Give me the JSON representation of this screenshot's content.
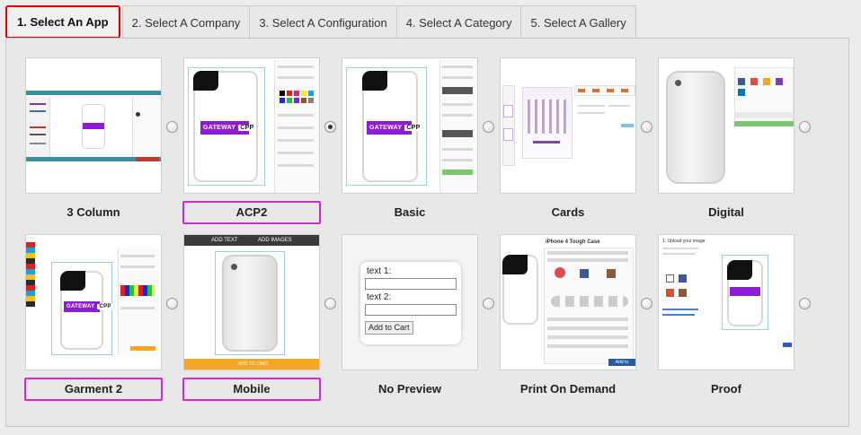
{
  "tabs": [
    {
      "label": "1. Select An App",
      "active": true
    },
    {
      "label": "2. Select A Company",
      "active": false
    },
    {
      "label": "3. Select A Configuration",
      "active": false
    },
    {
      "label": "4. Select A Category",
      "active": false
    },
    {
      "label": "5. Select A Gallery",
      "active": false
    }
  ],
  "apps": [
    {
      "name": "3 Column",
      "highlighted": false,
      "selected": false
    },
    {
      "name": "ACP2",
      "highlighted": true,
      "selected": false
    },
    {
      "name": "Basic",
      "highlighted": false,
      "selected": true
    },
    {
      "name": "Cards",
      "highlighted": false,
      "selected": false
    },
    {
      "name": "Digital",
      "highlighted": false,
      "selected": false
    },
    {
      "name": "Garment 2",
      "highlighted": true,
      "selected": false
    },
    {
      "name": "Mobile",
      "highlighted": true,
      "selected": false
    },
    {
      "name": "No Preview",
      "highlighted": false,
      "selected": false
    },
    {
      "name": "Print On Demand",
      "highlighted": false,
      "selected": false
    },
    {
      "name": "Proof",
      "highlighted": false,
      "selected": false
    }
  ],
  "previews": {
    "brand_text": "GATEWAY",
    "brand_badge": "CPP",
    "mobile_add_text": "ADD TEXT",
    "mobile_add_images": "ADD IMAGES",
    "mobile_footer": "ADD TO CART",
    "no_preview": {
      "text1_label": "text 1:",
      "text2_label": "text 2:",
      "button": "Add to Cart"
    },
    "print_on_demand_title": "iPhone 4 Tough Case",
    "print_on_demand_button": "Add to Basket",
    "proof_title": "1. Upload your image"
  },
  "colors": {
    "active_tab_border": "#e00000",
    "highlight_border": "#e020e0",
    "brand_purple": "#8f1bd6",
    "mobile_orange": "#f5a623"
  }
}
